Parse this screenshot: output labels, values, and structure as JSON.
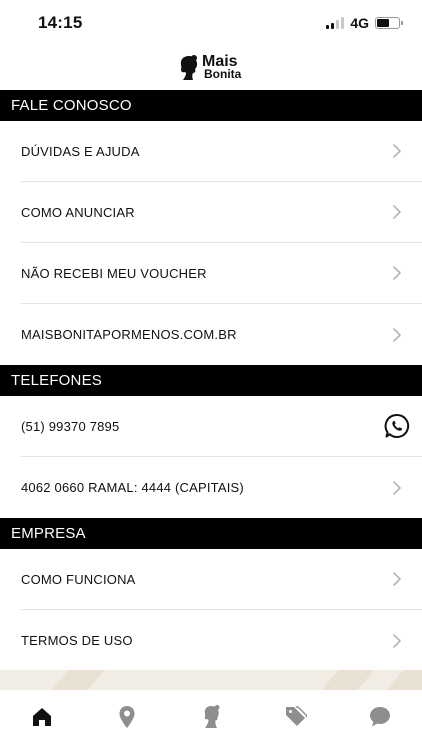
{
  "status_bar": {
    "time": "14:15",
    "network": "4G",
    "signal_bars_active": 2,
    "signal_bars_total": 4,
    "battery_level": 0.55
  },
  "logo": {
    "line1": "Mais",
    "line2": "Bonita"
  },
  "sections": [
    {
      "title": "FALE CONOSCO",
      "items": [
        {
          "label": "DÚVIDAS E AJUDA",
          "icon": "chevron-right-icon"
        },
        {
          "label": "COMO ANUNCIAR",
          "icon": "chevron-right-icon"
        },
        {
          "label": "NÃO RECEBI MEU VOUCHER",
          "icon": "chevron-right-icon"
        },
        {
          "label": "MAISBONITAPORMENOS.COM.BR",
          "icon": "chevron-right-icon"
        }
      ]
    },
    {
      "title": "TELEFONES",
      "items": [
        {
          "label": "(51) 99370 7895",
          "icon": "whatsapp-icon"
        },
        {
          "label": "4062 0660 RAMAL: 4444 (CAPITAIS)",
          "icon": "chevron-right-icon"
        }
      ]
    },
    {
      "title": "EMPRESA",
      "items": [
        {
          "label": "COMO FUNCIONA",
          "icon": "chevron-right-icon"
        },
        {
          "label": "TERMOS DE USO",
          "icon": "chevron-right-icon"
        }
      ]
    }
  ],
  "tabbar": {
    "items": [
      {
        "icon": "home-icon",
        "active": true
      },
      {
        "icon": "location-pin-icon",
        "active": false
      },
      {
        "icon": "woman-silhouette-icon",
        "active": false
      },
      {
        "icon": "price-tags-icon",
        "active": false
      },
      {
        "icon": "chat-bubble-icon",
        "active": false
      }
    ]
  },
  "colors": {
    "header_bg": "#000000",
    "active_icon": "#111111",
    "inactive_icon": "#8e8e8e",
    "chevron": "#b5b5b5"
  }
}
